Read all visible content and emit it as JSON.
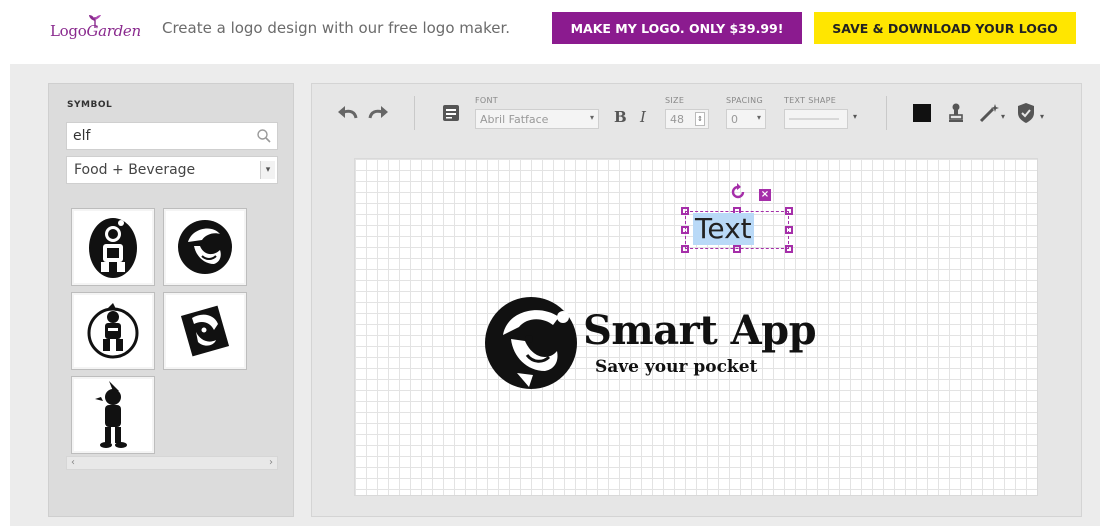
{
  "brand": {
    "name": "Logo Garden",
    "word_left": "Logo",
    "word_right": "Garden"
  },
  "header": {
    "tagline": "Create a logo design with our free logo maker.",
    "make_button": "MAKE MY LOGO. ONLY $39.99!",
    "save_button": "SAVE & DOWNLOAD YOUR LOGO",
    "colors": {
      "make": "#8b1b8f",
      "save": "#ffe600"
    }
  },
  "symbol_panel": {
    "title": "SYMBOL",
    "search_value": "elf",
    "category": "Food + Beverage",
    "symbols": [
      "elf-circle-icon",
      "jester-face-icon",
      "elf-ring-icon",
      "elf-card-icon",
      "elf-silhouette-icon"
    ]
  },
  "toolbar": {
    "font_label": "FONT",
    "font_value": "Abril Fatface",
    "bold": "B",
    "italic": "I",
    "size_label": "SIZE",
    "size_value": "48",
    "spacing_label": "SPACING",
    "spacing_value": "0",
    "shape_label": "TEXT SHAPE"
  },
  "canvas": {
    "selected_text": "Text",
    "logo_title": "Smart App",
    "logo_subtitle": "Save your pocket",
    "accent": "#a52ea9"
  }
}
